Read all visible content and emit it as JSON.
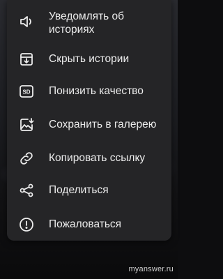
{
  "menu": {
    "items": [
      {
        "label": "Уведомлять об историях",
        "icon": "speaker-icon"
      },
      {
        "label": "Скрыть истории",
        "icon": "archive-box-icon"
      },
      {
        "label": "Понизить качество",
        "icon": "sd-quality-icon"
      },
      {
        "label": "Сохранить в галерею",
        "icon": "save-to-gallery-icon"
      },
      {
        "label": "Копировать ссылку",
        "icon": "link-icon"
      },
      {
        "label": "Поделиться",
        "icon": "share-icon"
      },
      {
        "label": "Пожаловаться",
        "icon": "report-icon"
      }
    ]
  },
  "watermark": "myanswer.ru",
  "colors": {
    "menu_bg": "#252527",
    "text": "#ececec"
  }
}
